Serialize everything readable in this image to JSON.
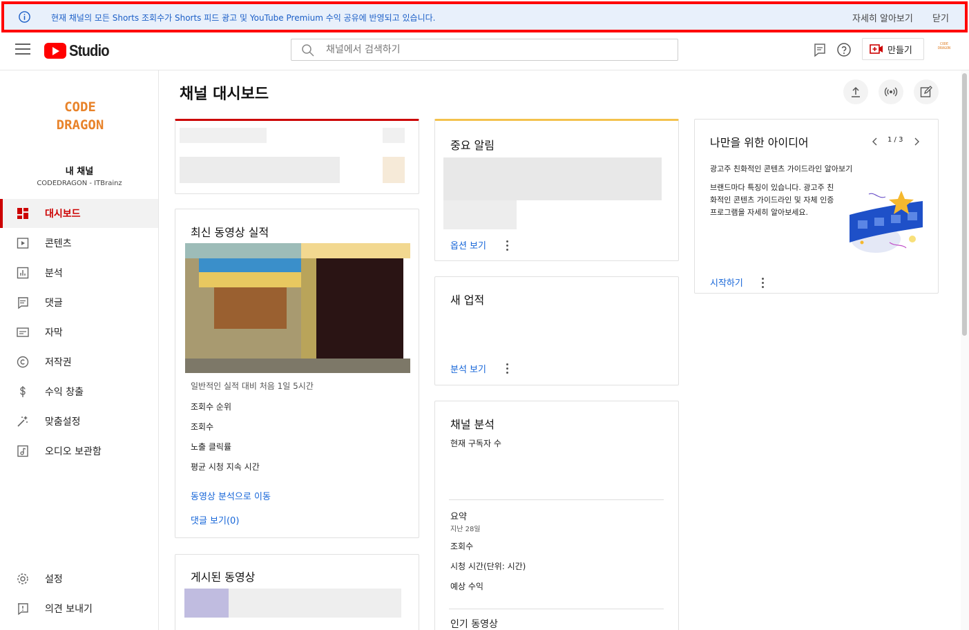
{
  "banner": {
    "message": "현재 채널의 모든 Shorts 조회수가 Shorts 피드 광고 및 YouTube Premium 수익 공유에 반영되고 있습니다.",
    "learn_more": "자세히 알아보기",
    "close": "닫기"
  },
  "header": {
    "logo_text": "Studio",
    "search_placeholder": "채널에서 검색하기",
    "create_label": "만들기",
    "avatar_text": "CODE DRAGON"
  },
  "sidebar": {
    "channel_logo_line1": "CODE",
    "channel_logo_line2": "DRAGON",
    "channel_title": "내 채널",
    "channel_subtitle": "CODEDRAGON - ITBrainz",
    "items": [
      {
        "label": "대시보드",
        "icon": "dashboard-icon",
        "active": true
      },
      {
        "label": "콘텐츠",
        "icon": "content-icon"
      },
      {
        "label": "분석",
        "icon": "analytics-icon"
      },
      {
        "label": "댓글",
        "icon": "comments-icon"
      },
      {
        "label": "자막",
        "icon": "subtitles-icon"
      },
      {
        "label": "저작권",
        "icon": "copyright-icon"
      },
      {
        "label": "수익 창출",
        "icon": "monetization-icon"
      },
      {
        "label": "맞춤설정",
        "icon": "customization-icon"
      },
      {
        "label": "오디오 보관함",
        "icon": "audio-library-icon"
      }
    ],
    "bottom_items": [
      {
        "label": "설정",
        "icon": "settings-icon"
      },
      {
        "label": "의견 보내기",
        "icon": "feedback-icon"
      }
    ]
  },
  "main": {
    "title": "채널 대시보드",
    "latest_video": {
      "title": "최신 동영상 실적",
      "first_hours": "일반적인 실적 대비 처음 1일 5시간",
      "metrics": [
        "조회수 순위",
        "조회수",
        "노출 클릭률",
        "평균 시청 지속 시간"
      ],
      "go_analytics": "동영상 분석으로 이동",
      "view_comments": "댓글 보기(0)"
    },
    "published_videos": {
      "title": "게시된 동영상"
    },
    "important_alerts": {
      "title": "중요 알림",
      "link": "옵션 보기"
    },
    "new_achievements": {
      "title": "새 업적",
      "link": "분석 보기"
    },
    "channel_analytics": {
      "title": "채널 분석",
      "current_subscribers": "현재 구독자 수",
      "summary_title": "요약",
      "summary_period": "지난 28일",
      "summary_metrics": [
        "조회수",
        "시청 시간(단위: 시간)",
        "예상 수익"
      ],
      "top_videos": "인기 동영상"
    },
    "ideas": {
      "title": "나만을 위한 아이디어",
      "pager": "1 / 3",
      "subtitle": "광고주 친화적인 콘텐츠 가이드라인 알아보기",
      "body": "브랜드마다 특징이 있습니다. 광고주 친화적인 콘텐츠 가이드라인 및 자체 인증 프로그램을 자세히 알아보세요.",
      "cta": "시작하기"
    }
  },
  "colors": {
    "accent_red": "#cc0000",
    "link_blue": "#1565d8",
    "banner_bg": "#e8f0fb",
    "logo_orange": "#e8832a"
  }
}
